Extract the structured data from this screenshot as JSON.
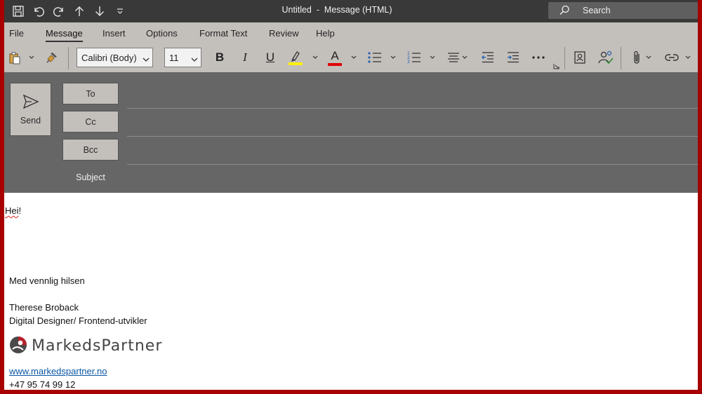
{
  "titlebar": {
    "title": "Untitled  -  Message (HTML)",
    "search_placeholder": "Search",
    "quick_access_icons": [
      "save-icon",
      "undo-icon",
      "redo-icon",
      "up-arrow-icon",
      "down-arrow-icon",
      "customize-qat-icon"
    ]
  },
  "menu": {
    "tabs": [
      {
        "label": "File"
      },
      {
        "label": "Message",
        "active": true
      },
      {
        "label": "Insert"
      },
      {
        "label": "Options"
      },
      {
        "label": "Format Text"
      },
      {
        "label": "Review"
      },
      {
        "label": "Help"
      }
    ]
  },
  "ribbon": {
    "font_family": "Calibri (Body)",
    "font_size": "11",
    "bold": "B",
    "italic": "I",
    "underline": "U",
    "font_color_letter": "A",
    "highlight_color": "#ffef00",
    "font_color": "#e00000",
    "icons": [
      "paste-icon",
      "format-painter-icon",
      "bullets-icon",
      "numbering-icon",
      "align-icon",
      "decrease-indent-icon",
      "increase-indent-icon",
      "more-icon",
      "dialog-launcher-icon",
      "address-book-icon",
      "check-names-icon",
      "attach-file-icon",
      "link-icon"
    ]
  },
  "header": {
    "send_label": "Send",
    "to_label": "To",
    "cc_label": "Cc",
    "bcc_label": "Bcc",
    "subject_label": "Subject"
  },
  "body": {
    "greeting_word": "Hei",
    "greeting_punct": "!",
    "closing": "Med vennlig hilsen",
    "name": "Therese Broback",
    "role": "Digital Designer/ Frontend-utvikler",
    "logo_text": "MarkedsPartner",
    "website": "www.markedspartner.no",
    "phone": "+47 95 74 99 12"
  },
  "colors": {
    "frame_border": "#a80000",
    "titlebar": "#393939",
    "ribbon": "#c3bfbb",
    "header": "#666666",
    "link": "#0a57a4"
  }
}
